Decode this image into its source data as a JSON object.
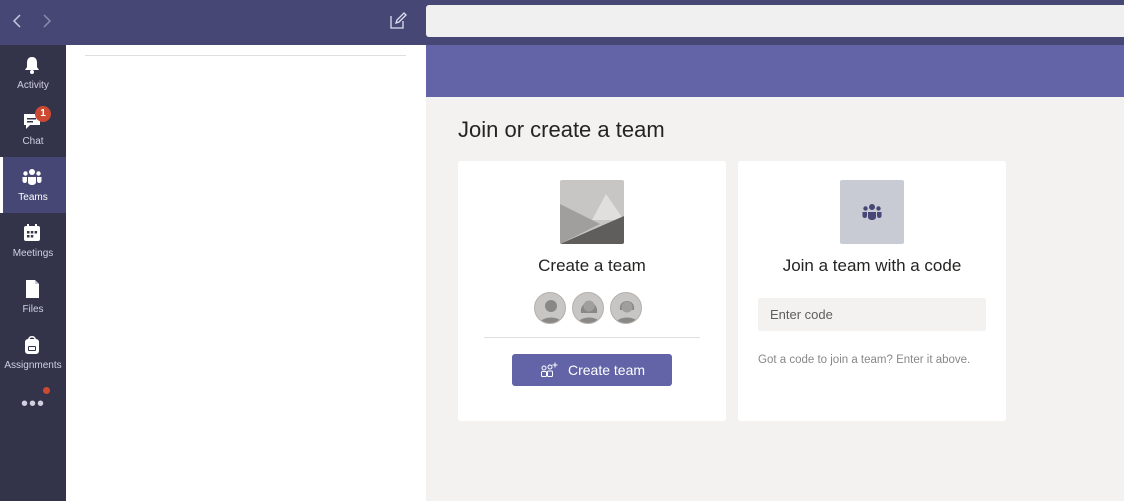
{
  "rail": {
    "items": [
      {
        "label": "Activity",
        "icon": "bell-icon"
      },
      {
        "label": "Chat",
        "icon": "chat-icon",
        "badge": "1"
      },
      {
        "label": "Teams",
        "icon": "teams-icon",
        "active": true
      },
      {
        "label": "Meetings",
        "icon": "calendar-icon"
      },
      {
        "label": "Files",
        "icon": "file-icon"
      },
      {
        "label": "Assignments",
        "icon": "backpack-icon"
      }
    ],
    "more_label": "•••"
  },
  "main": {
    "title": "Join or create a team",
    "create_card": {
      "title": "Create a team",
      "button_label": "Create team"
    },
    "join_card": {
      "title": "Join a team with a code",
      "input_placeholder": "Enter code",
      "hint": "Got a code to join a team? Enter it above."
    }
  },
  "colors": {
    "brand": "#6264a7",
    "topbar": "#464775",
    "rail": "#33344a",
    "badge": "#cc4a31"
  }
}
